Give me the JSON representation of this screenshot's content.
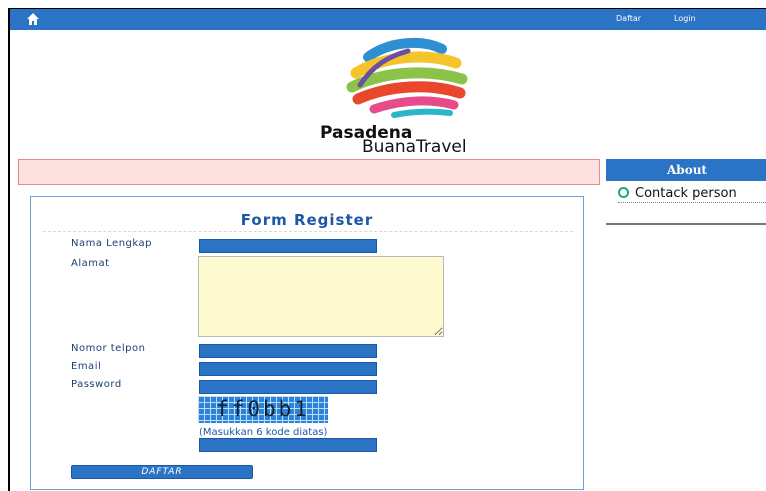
{
  "topbar": {
    "home_icon": "home-icon",
    "links": {
      "daftar": "Daftar",
      "login": "Login"
    }
  },
  "logo": {
    "line1": "Pasadena",
    "line2": "BuanaTravel"
  },
  "sidebar": {
    "about_title": "About",
    "items": [
      {
        "label": "Contack person",
        "icon": "circle-bullet-icon"
      }
    ]
  },
  "form": {
    "title": "Form Register",
    "fields": {
      "nama_lengkap": {
        "label": "Nama Lengkap",
        "value": ""
      },
      "alamat": {
        "label": "Alamat",
        "value": ""
      },
      "nomor_telpon": {
        "label": "Nomor telpon",
        "value": ""
      },
      "email": {
        "label": "Email",
        "value": ""
      },
      "password": {
        "label": "Password",
        "value": ""
      }
    },
    "captcha": {
      "text": "ff0bb1",
      "hint": "(Masukkan 6 kode diatas)",
      "value": ""
    },
    "submit_label": "DAFTAR"
  },
  "colors": {
    "primary": "#2b73c4",
    "alert_bg": "#fde0e0",
    "textarea_bg": "#fefbd0",
    "accent_green": "#2aa46d"
  }
}
